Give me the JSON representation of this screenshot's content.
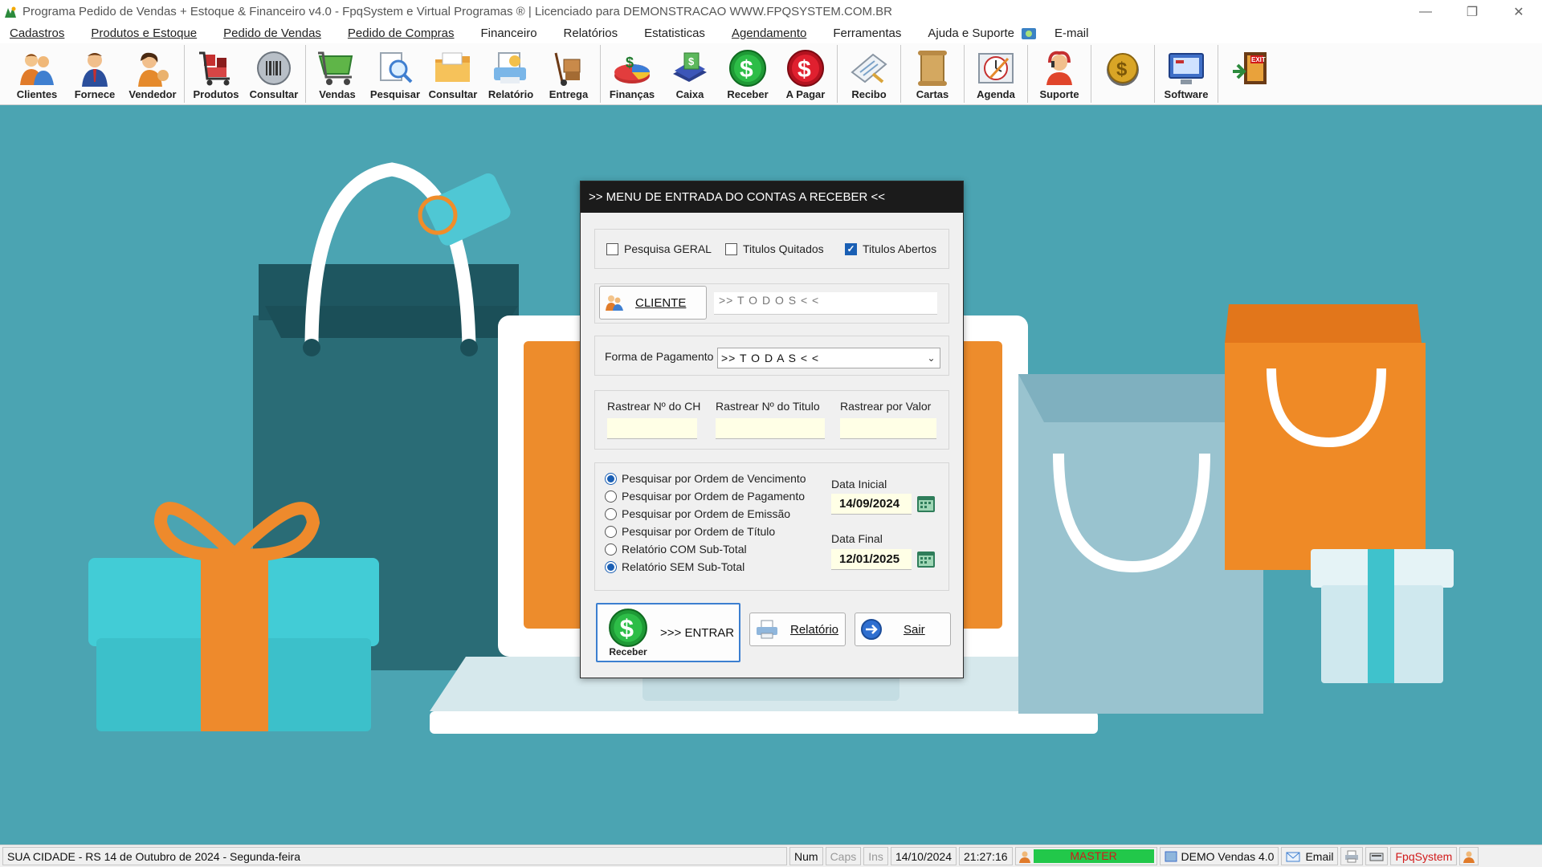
{
  "window": {
    "title": "Programa Pedido de Vendas + Estoque & Financeiro v4.0 - FpqSystem e Virtual Programas ® | Licenciado para  DEMONSTRACAO WWW.FPQSYSTEM.COM.BR"
  },
  "menu": {
    "items": [
      "Cadastros",
      "Produtos e Estoque",
      "Pedido de Vendas",
      "Pedido de Compras",
      "Financeiro",
      "Relatórios",
      "Estatisticas",
      "Agendamento",
      "Ferramentas",
      "Ajuda e Suporte",
      "E-mail"
    ]
  },
  "toolbar": {
    "buttons": [
      {
        "label": "Clientes",
        "icon": "clients-icon"
      },
      {
        "label": "Fornece",
        "icon": "supplier-icon"
      },
      {
        "label": "Vendedor",
        "icon": "seller-icon"
      },
      {
        "label": "Produtos",
        "icon": "products-cart-icon"
      },
      {
        "label": "Consultar",
        "icon": "barcode-icon"
      },
      {
        "label": "Vendas",
        "icon": "shopping-cart-icon"
      },
      {
        "label": "Pesquisar",
        "icon": "magnifier-icon"
      },
      {
        "label": "Consultar",
        "icon": "folder-icon"
      },
      {
        "label": "Relatório",
        "icon": "report-icon"
      },
      {
        "label": "Entrega",
        "icon": "hand-truck-icon"
      },
      {
        "label": "Finanças",
        "icon": "finance-chart-icon"
      },
      {
        "label": "Caixa",
        "icon": "cash-book-icon"
      },
      {
        "label": "Receber",
        "icon": "dollar-green-icon"
      },
      {
        "label": "A Pagar",
        "icon": "dollar-red-icon"
      },
      {
        "label": "Recibo",
        "icon": "receipt-icon"
      },
      {
        "label": "Cartas",
        "icon": "scroll-icon"
      },
      {
        "label": "Agenda",
        "icon": "clock-icon"
      },
      {
        "label": "Suporte",
        "icon": "support-icon"
      },
      {
        "label": "",
        "icon": "coin-icon"
      },
      {
        "label": "Software",
        "icon": "software-icon"
      },
      {
        "label": "",
        "icon": "exit-icon"
      }
    ]
  },
  "dialog": {
    "title": ">>  MENU DE ENTRADA DO CONTAS A RECEBER  <<",
    "checks": [
      {
        "label": "Pesquisa GERAL",
        "checked": false
      },
      {
        "label": "Titulos Quitados",
        "checked": false
      },
      {
        "label": "Titulos Abertos",
        "checked": true
      }
    ],
    "cliente_button": "CLIENTE",
    "cliente_value": ">> T O D O S < <",
    "forma_label": "Forma de Pagamento",
    "forma_value": ">> T O D A S < <",
    "rastrear": {
      "ch_label": "Rastrear Nº do CH",
      "titulo_label": "Rastrear Nº do Titulo",
      "valor_label": "Rastrear por Valor"
    },
    "order_options": [
      {
        "label": "Pesquisar por Ordem de Vencimento",
        "selected": true
      },
      {
        "label": "Pesquisar por Ordem de Pagamento",
        "selected": false
      },
      {
        "label": "Pesquisar por Ordem de Emissão",
        "selected": false
      },
      {
        "label": "Pesquisar por Ordem de Título",
        "selected": false
      },
      {
        "label": "Relatório COM Sub-Total",
        "selected": false
      },
      {
        "label": "Relatório SEM Sub-Total",
        "selected": true
      }
    ],
    "data_inicial_label": "Data Inicial",
    "data_inicial": "14/09/2024",
    "data_final_label": "Data Final",
    "data_final": "12/01/2025",
    "entrar_icon_label": "Receber",
    "entrar_label": ">>> ENTRAR",
    "relatorio_label": "Relatório",
    "sair_label": "Sair"
  },
  "status": {
    "location": "SUA CIDADE - RS 14 de Outubro de 2024 - Segunda-feira",
    "num": "Num",
    "caps": "Caps",
    "ins": "Ins",
    "date": "14/10/2024",
    "time": "21:27:16",
    "user": "MASTER",
    "version": "DEMO Vendas 4.0",
    "email": "Email",
    "brand": "FpqSystem"
  },
  "colors": {
    "background": "#4ba4b2",
    "accent_blue": "#1a5fb4",
    "status_green": "#22c84a",
    "status_red": "#d11a1a"
  }
}
